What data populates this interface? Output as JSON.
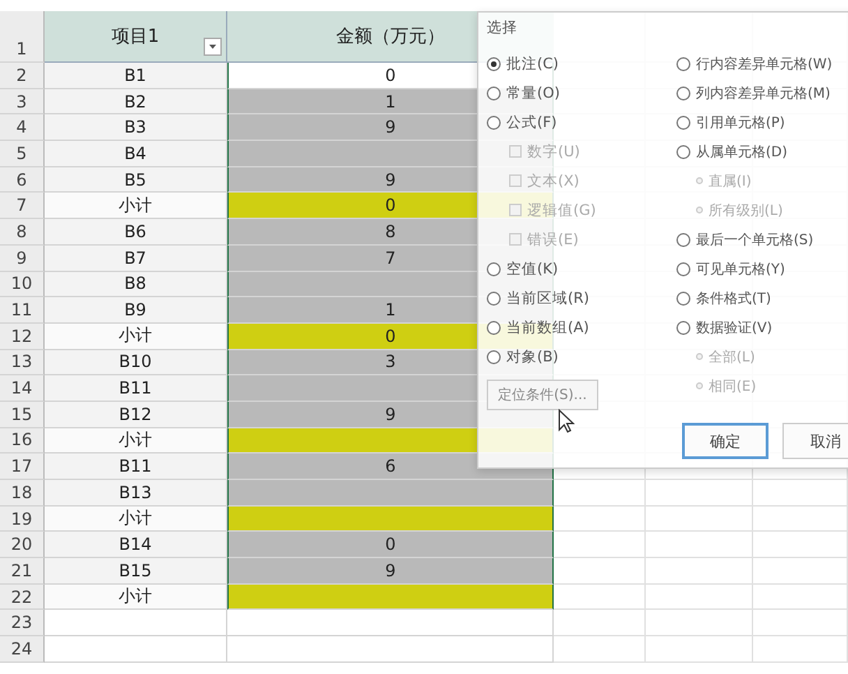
{
  "sheet": {
    "header_row": "1",
    "headers": [
      "项目1",
      "金额（万元）"
    ],
    "rows": [
      {
        "num": "2",
        "item": "B1",
        "amount": "0",
        "kind": "plain"
      },
      {
        "num": "3",
        "item": "B2",
        "amount": "1",
        "kind": "gray"
      },
      {
        "num": "4",
        "item": "B3",
        "amount": "9",
        "kind": "gray"
      },
      {
        "num": "5",
        "item": "B4",
        "kind": "gray"
      },
      {
        "num": "6",
        "item": "B5",
        "amount": "9",
        "kind": "gray"
      },
      {
        "num": "7",
        "item": "小计",
        "amount": "0",
        "kind": "yellow"
      },
      {
        "num": "8",
        "item": "B6",
        "amount": "8",
        "kind": "gray"
      },
      {
        "num": "9",
        "item": "B7",
        "amount": "7",
        "kind": "gray"
      },
      {
        "num": "10",
        "item": "B8",
        "kind": "gray"
      },
      {
        "num": "11",
        "item": "B9",
        "amount": "1",
        "kind": "gray"
      },
      {
        "num": "12",
        "item": "小计",
        "amount": "0",
        "kind": "yellow"
      },
      {
        "num": "13",
        "item": "B10",
        "amount": "3",
        "kind": "gray"
      },
      {
        "num": "14",
        "item": "B11",
        "kind": "gray"
      },
      {
        "num": "15",
        "item": "B12",
        "amount": "9",
        "kind": "gray"
      },
      {
        "num": "16",
        "item": "小计",
        "kind": "yellow"
      },
      {
        "num": "17",
        "item": "B11",
        "amount": "6",
        "kind": "gray"
      },
      {
        "num": "18",
        "item": "B13",
        "kind": "gray"
      },
      {
        "num": "19",
        "item": "小计",
        "kind": "yellow"
      },
      {
        "num": "20",
        "item": "B14",
        "amount": "0",
        "kind": "gray"
      },
      {
        "num": "21",
        "item": "B15",
        "amount": "9",
        "kind": "gray"
      },
      {
        "num": "22",
        "item": "小计",
        "kind": "yellow"
      },
      {
        "num": "23",
        "kind": "empty"
      },
      {
        "num": "24",
        "kind": "empty"
      }
    ]
  },
  "dialog": {
    "title": "选择",
    "left": [
      {
        "label": "批注(C)",
        "kind": "radio",
        "selected": true,
        "disabled": false
      },
      {
        "label": "常量(O)",
        "kind": "radio",
        "selected": false,
        "disabled": false
      },
      {
        "label": "公式(F)",
        "kind": "radio",
        "selected": false,
        "disabled": false
      },
      {
        "label": "数字(U)",
        "kind": "check",
        "selected": false,
        "disabled": true
      },
      {
        "label": "文本(X)",
        "kind": "check",
        "selected": false,
        "disabled": true
      },
      {
        "label": "逻辑值(G)",
        "kind": "check",
        "selected": false,
        "disabled": true
      },
      {
        "label": "错误(E)",
        "kind": "check",
        "selected": false,
        "disabled": true
      },
      {
        "label": "空值(K)",
        "kind": "radio",
        "selected": false,
        "disabled": false
      },
      {
        "label": "当前区域(R)",
        "kind": "radio",
        "selected": false,
        "disabled": false
      },
      {
        "label": "当前数组(A)",
        "kind": "radio",
        "selected": false,
        "disabled": false
      },
      {
        "label": "对象(B)",
        "kind": "radio",
        "selected": false,
        "disabled": false
      }
    ],
    "right": [
      {
        "label": "行内容差异单元格(W)",
        "kind": "radio",
        "selected": false,
        "disabled": false
      },
      {
        "label": "列内容差异单元格(M)",
        "kind": "radio",
        "selected": false,
        "disabled": false
      },
      {
        "label": "引用单元格(P)",
        "kind": "radio",
        "selected": false,
        "disabled": false
      },
      {
        "label": "从属单元格(D)",
        "kind": "radio",
        "selected": false,
        "disabled": false
      },
      {
        "label": "直属(I)",
        "kind": "sub",
        "selected": false,
        "disabled": true
      },
      {
        "label": "所有级别(L)",
        "kind": "sub",
        "selected": false,
        "disabled": true
      },
      {
        "label": "最后一个单元格(S)",
        "kind": "radio",
        "selected": false,
        "disabled": false
      },
      {
        "label": "可见单元格(Y)",
        "kind": "radio",
        "selected": false,
        "disabled": false
      },
      {
        "label": "条件格式(T)",
        "kind": "radio",
        "selected": false,
        "disabled": false
      },
      {
        "label": "数据验证(V)",
        "kind": "radio",
        "selected": false,
        "disabled": false
      },
      {
        "label": "全部(L)",
        "kind": "sub",
        "selected": false,
        "disabled": true
      },
      {
        "label": "相同(E)",
        "kind": "sub",
        "selected": false,
        "disabled": true
      }
    ],
    "special_button": "定位条件(S)...",
    "ok": "确定",
    "cancel": "取消"
  }
}
